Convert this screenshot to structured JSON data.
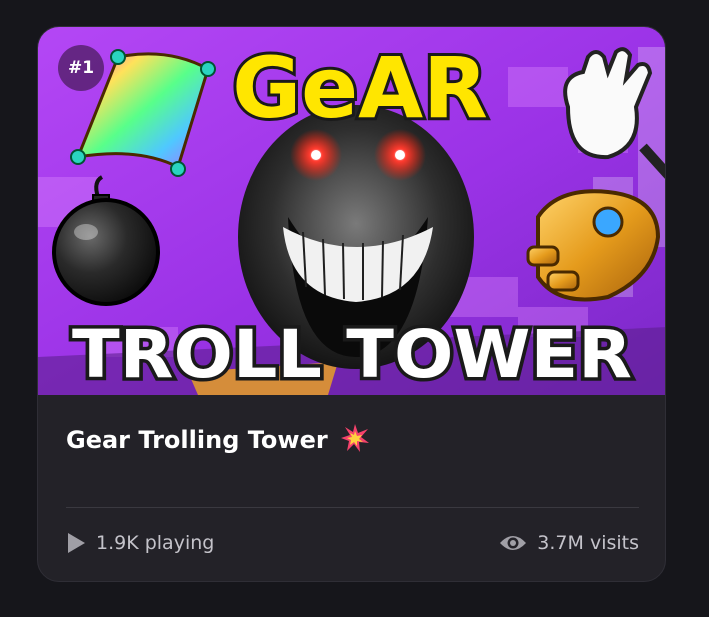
{
  "card": {
    "rank": "#1",
    "thumbnail_text": {
      "line1": "GeAR",
      "line2": "TROLL TOWER"
    },
    "title": "Gear Trolling Tower",
    "title_icon": "collision-icon",
    "playing": "1.9K playing",
    "playing_icon": "play-icon",
    "visits": "3.7M visits",
    "visits_icon": "eye-icon"
  },
  "colors": {
    "background": "#16161b",
    "card": "#232228",
    "text": "#ffffff",
    "muted_text": "#c4c3ca",
    "thumbnail_purple": "#a23cf2",
    "thumbnail_yellow": "#ffe600"
  }
}
